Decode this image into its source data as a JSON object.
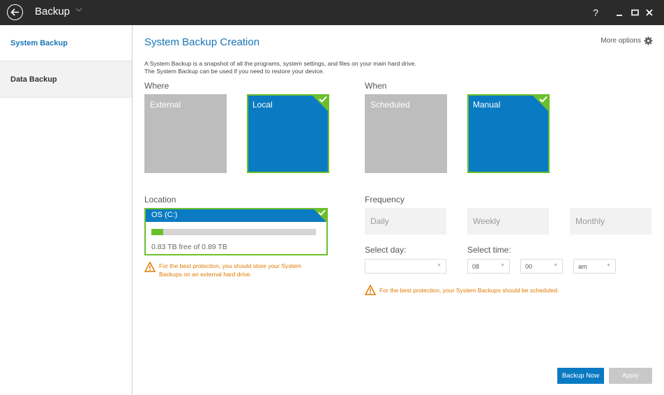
{
  "window": {
    "title": "Backup",
    "help_label": "?",
    "colors": {
      "titlebar": "#2b2b2b",
      "accent": "#0a7bc2",
      "selected_border": "#6cbf2c",
      "warning": "#e07a00"
    }
  },
  "sidebar": {
    "items": [
      {
        "label": "System Backup",
        "active": true
      },
      {
        "label": "Data Backup",
        "active": false
      }
    ]
  },
  "main": {
    "title": "System Backup Creation",
    "more_options": "More options",
    "description_line1": "A System Backup is a snapshot of all the programs, system settings, and files on your main hard drive.",
    "description_line2": "The System Backup can be used if you need to restore your device."
  },
  "where": {
    "label": "Where",
    "options": [
      {
        "label": "External",
        "selected": false
      },
      {
        "label": "Local",
        "selected": true
      }
    ]
  },
  "when": {
    "label": "When",
    "options": [
      {
        "label": "Scheduled",
        "selected": false
      },
      {
        "label": "Manual",
        "selected": true
      }
    ]
  },
  "location": {
    "label": "Location",
    "drive_name": "OS (C:)",
    "free_text": "0.83 TB free of 0.89 TB",
    "used_fraction": 0.07,
    "warning_line1": "For the best protection, you should store your System",
    "warning_line2": "Backups on an external hard drive."
  },
  "frequency": {
    "label": "Frequency",
    "options": [
      "Daily",
      "Weekly",
      "Monthly"
    ],
    "select_day_label": "Select day:",
    "select_day_value": "",
    "select_time_label": "Select time:",
    "hour": "08",
    "minute": "00",
    "ampm": "am",
    "warning": "For the best protection, your System Backups should be scheduled."
  },
  "actions": {
    "backup_now": "Backup Now",
    "apply": "Apply"
  }
}
